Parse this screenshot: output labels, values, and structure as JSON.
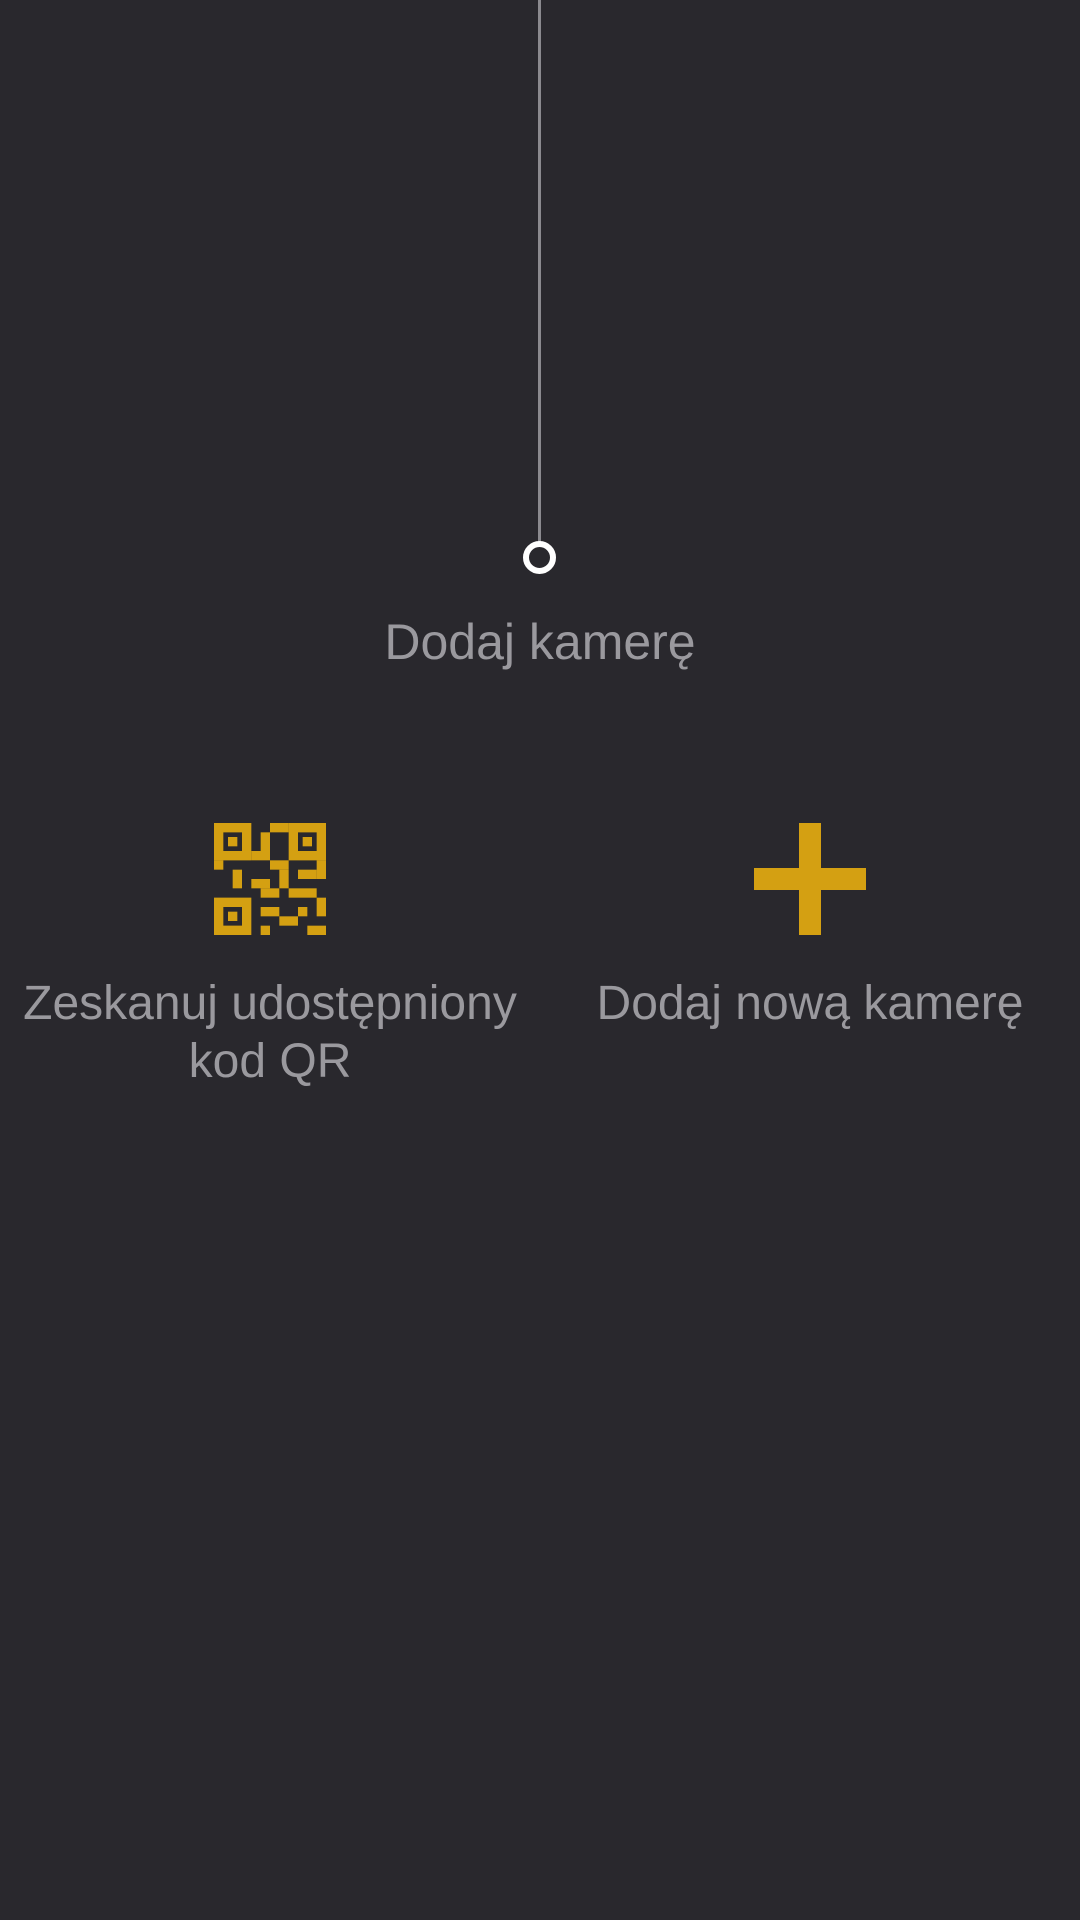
{
  "heading": "Dodaj kamerę",
  "options": [
    {
      "label": "Zeskanuj udostępniony kod QR",
      "icon": "qr-code-icon"
    },
    {
      "label": "Dodaj nową kamerę",
      "icon": "plus-icon"
    }
  ],
  "colors": {
    "background": "#29282d",
    "accent": "#d4a012",
    "text": "#9a999e",
    "line": "#8b8a8f",
    "node": "#ffffff"
  }
}
